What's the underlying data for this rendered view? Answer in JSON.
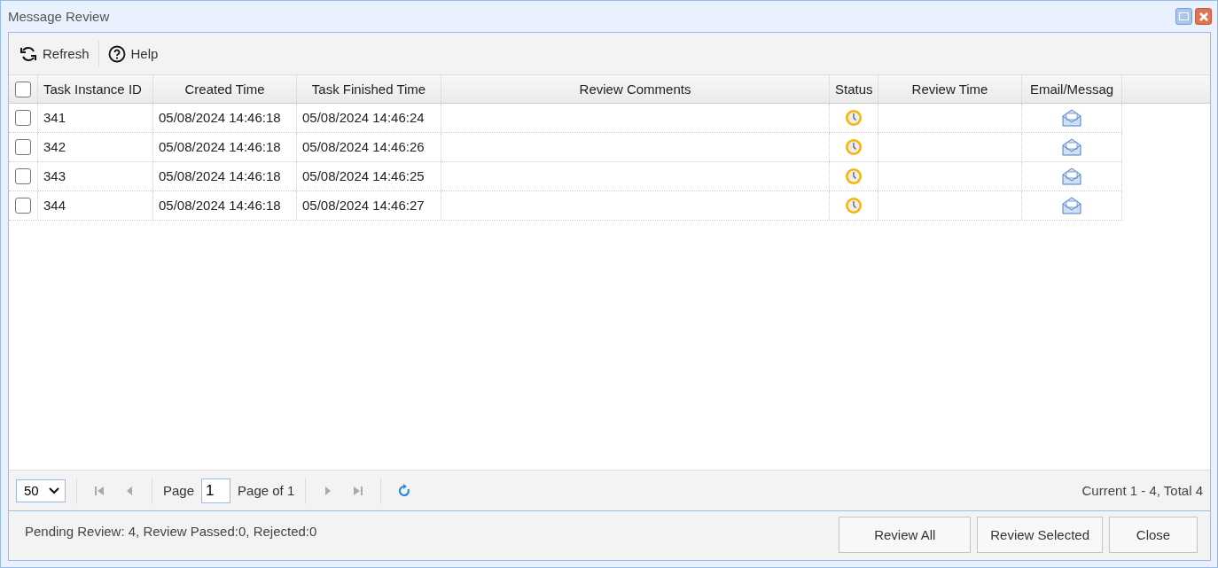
{
  "window": {
    "title": "Message Review"
  },
  "toolbar": [
    {
      "kind": "refresh",
      "label": "Refresh"
    },
    {
      "kind": "help",
      "label": "Help"
    }
  ],
  "table": {
    "select_all": {
      "checked": false
    },
    "columns": [
      "Task Instance ID",
      "Created Time",
      "Task Finished Time",
      "Review Comments",
      "Status",
      "Review Time",
      "Email/Messag"
    ],
    "rows": [
      {
        "checked": false,
        "id": "341",
        "created": "05/08/2024 14:46:18",
        "finished": "05/08/2024 14:46:24",
        "kind": "pending"
      },
      {
        "checked": false,
        "id": "342",
        "created": "05/08/2024 14:46:18",
        "finished": "05/08/2024 14:46:26",
        "kind": "pending"
      },
      {
        "checked": false,
        "id": "343",
        "created": "05/08/2024 14:46:18",
        "finished": "05/08/2024 14:46:25",
        "kind": "pending"
      },
      {
        "checked": false,
        "id": "344",
        "created": "05/08/2024 14:46:18",
        "finished": "05/08/2024 14:46:27",
        "kind": "pending"
      }
    ]
  },
  "pager": {
    "page_size": "50",
    "page_label": "Page",
    "page": "1",
    "page_of": "Page of 1",
    "summary": "Current 1 - 4, Total 4"
  },
  "footer": {
    "status_text": "Pending Review: 4, Review Passed:0, Rejected:0",
    "buttons": [
      "Review All",
      "Review Selected",
      "Close"
    ]
  }
}
